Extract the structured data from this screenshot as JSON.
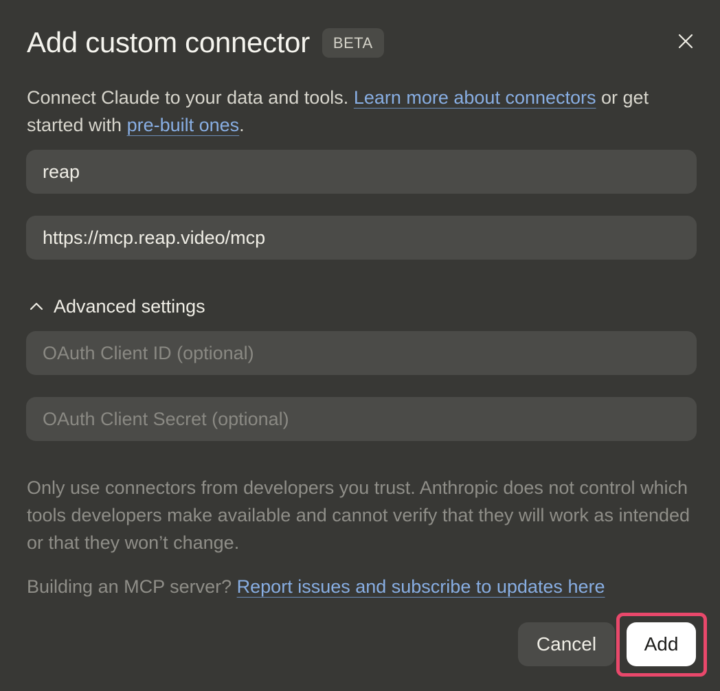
{
  "dialog": {
    "title": "Add custom connector",
    "badge": "BETA",
    "close_icon": "close-icon"
  },
  "intro": {
    "text_before_link1": "Connect Claude to your data and tools. ",
    "link1": "Learn more about connectors",
    "text_between": " or get started with ",
    "link2": "pre-built ones",
    "text_after": "."
  },
  "fields": {
    "name_value": "reap",
    "url_value": "https://mcp.reap.video/mcp",
    "client_id_placeholder": "OAuth Client ID (optional)",
    "client_secret_placeholder": "OAuth Client Secret (optional)"
  },
  "advanced": {
    "label": "Advanced settings",
    "icon": "chevron-up-icon",
    "expanded": true
  },
  "warning": "Only use connectors from developers you trust. Anthropic does not control which tools developers make available and cannot verify that they will work as intended or that they won’t change.",
  "building": {
    "text": "Building an MCP server? ",
    "link": "Report issues and subscribe to updates here"
  },
  "buttons": {
    "cancel": "Cancel",
    "add": "Add"
  },
  "colors": {
    "background": "#383835",
    "field": "#4b4b48",
    "link": "#88aee3",
    "highlight": "#e9486b"
  }
}
